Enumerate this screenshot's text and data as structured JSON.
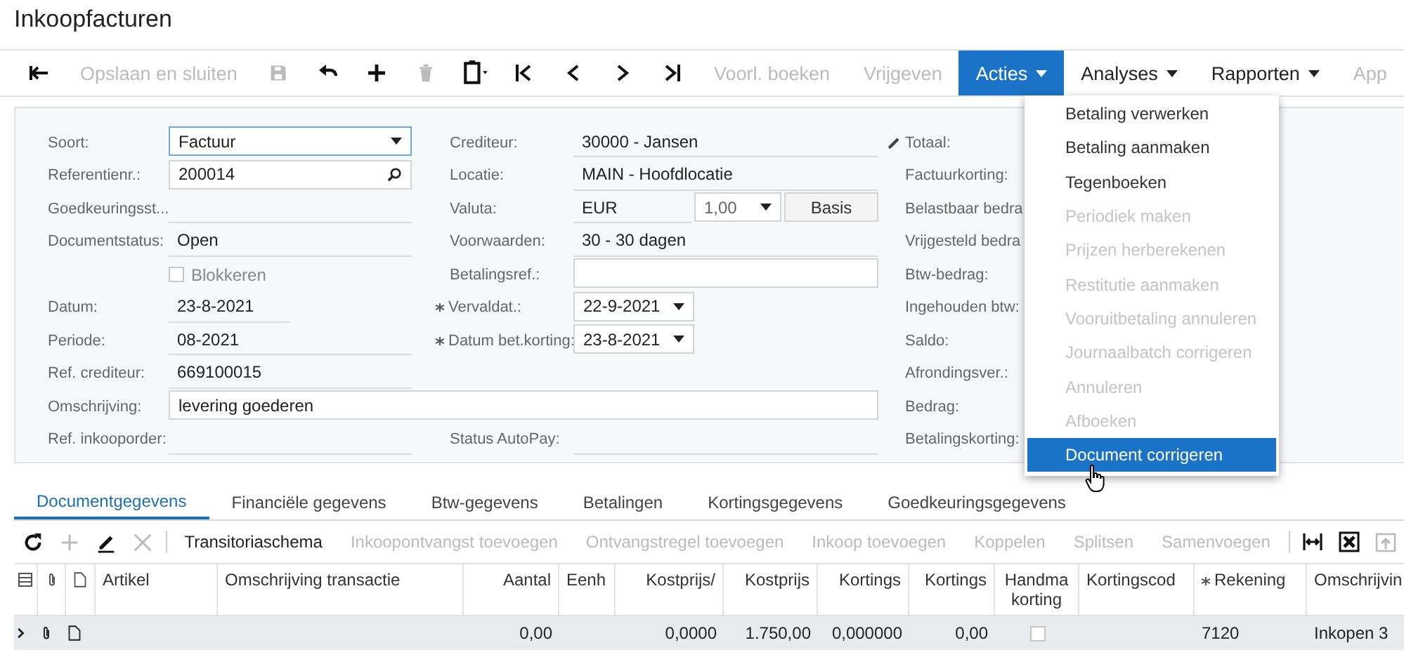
{
  "window": {
    "title": "Inkoopfacturen"
  },
  "toolbar": [
    {
      "kind": "icon",
      "disabled": false
    },
    {
      "kind": "text",
      "label": "Opslaan en sluiten",
      "disabled": true
    },
    {
      "kind": "icon",
      "disabled": true
    },
    {
      "kind": "icon",
      "disabled": false
    },
    {
      "kind": "icon",
      "disabled": false
    },
    {
      "kind": "icon",
      "disabled": true
    },
    {
      "kind": "icon",
      "disabled": false
    },
    {
      "kind": "icon",
      "disabled": false
    },
    {
      "kind": "icon",
      "disabled": false
    },
    {
      "kind": "icon",
      "disabled": false
    },
    {
      "kind": "icon",
      "disabled": false
    },
    {
      "kind": "text",
      "label": "Voorl. boeken",
      "disabled": true
    },
    {
      "kind": "text",
      "label": "Vrijgeven",
      "disabled": true
    },
    {
      "kind": "menu",
      "label": "Acties",
      "disabled": false,
      "expanded": true
    },
    {
      "kind": "menu",
      "label": "Analyses",
      "disabled": false,
      "expanded": false
    },
    {
      "kind": "menu",
      "label": "Rapporten",
      "disabled": false,
      "expanded": false
    },
    {
      "kind": "text",
      "label": "App",
      "disabled": true
    }
  ],
  "actions_menu": [
    {
      "label": "Betaling verwerken",
      "disabled": false,
      "highlighted": false
    },
    {
      "label": "Betaling aanmaken",
      "disabled": false,
      "highlighted": false
    },
    {
      "label": "Tegenboeken",
      "disabled": false,
      "highlighted": false
    },
    {
      "label": "Periodiek maken",
      "disabled": true,
      "highlighted": false
    },
    {
      "label": "Prijzen herberekenen",
      "disabled": true,
      "highlighted": false
    },
    {
      "label": "Restitutie aanmaken",
      "disabled": true,
      "highlighted": false
    },
    {
      "label": "Vooruitbetaling annuleren",
      "disabled": true,
      "highlighted": false
    },
    {
      "label": "Journaalbatch corrigeren",
      "disabled": true,
      "highlighted": false
    },
    {
      "label": "Annuleren",
      "disabled": true,
      "highlighted": false
    },
    {
      "label": "Afboeken",
      "disabled": true,
      "highlighted": false
    },
    {
      "label": "Document corrigeren",
      "disabled": false,
      "highlighted": true
    }
  ],
  "form": {
    "left": [
      {
        "label": "Soort:",
        "kind": "select",
        "value": "Factuur",
        "focused": true
      },
      {
        "label": "Referentienr.:",
        "kind": "search",
        "value": "200014"
      },
      {
        "label": "Goedkeuringsst...",
        "kind": "readonly"
      },
      {
        "label": "Documentstatus:",
        "kind": "readonly",
        "value": "Open"
      },
      {
        "kind": "checkbox",
        "label": "Blokkeren",
        "checked": false
      },
      {
        "label": "Datum:",
        "kind": "readonly-short",
        "value": "23-8-2021"
      },
      {
        "label": "Periode:",
        "kind": "readonly",
        "value": "08-2021"
      },
      {
        "label": "Ref. crediteur:",
        "kind": "readonly",
        "value": "669100015"
      },
      {
        "label": "Omschrijving:",
        "kind": "wide-input",
        "value": "levering goederen"
      },
      {
        "label": "Ref. inkooporder:",
        "kind": "readonly"
      }
    ],
    "middle": [
      {
        "label": "Crediteur:",
        "kind": "readonly",
        "value": "30000 - Jansen"
      },
      {
        "label": "Locatie:",
        "kind": "readonly",
        "value": "MAIN - Hoofdlocatie"
      },
      {
        "label": "Valuta:",
        "kind": "currency",
        "value": "EUR",
        "rate": "1,00",
        "button": "Basis"
      },
      {
        "label": "Voorwaarden:",
        "kind": "readonly",
        "value": "30 - 30 dagen"
      },
      {
        "label": "Betalingsref.:",
        "kind": "input"
      },
      {
        "label": "Vervaldat.:",
        "kind": "date",
        "value": "22-9-2021",
        "required": true
      },
      {
        "label": "Datum bet.korting:",
        "kind": "date",
        "value": "23-8-2021",
        "required": true
      },
      {
        "label": "Status AutoPay:",
        "kind": "readonly"
      }
    ],
    "right": [
      {
        "label": "Totaal:",
        "editable": true
      },
      {
        "label": "Factuurkorting:",
        "editable": false
      },
      {
        "label": "Belastbaar bedra",
        "editable": false
      },
      {
        "label": "Vrijgesteld bedra",
        "editable": false
      },
      {
        "label": "Btw-bedrag:",
        "editable": false
      },
      {
        "label": "Ingehouden btw:",
        "editable": false
      },
      {
        "label": "Saldo:",
        "editable": false
      },
      {
        "label": "Afrondingsver.:",
        "editable": false
      },
      {
        "label": "Bedrag:",
        "editable": false
      },
      {
        "label": "Betalingskorting:",
        "editable": false
      }
    ]
  },
  "tabs": [
    {
      "label": "Documentgegevens",
      "selected": true
    },
    {
      "label": "Financiële gegevens",
      "selected": false
    },
    {
      "label": "Btw-gegevens",
      "selected": false
    },
    {
      "label": "Betalingen",
      "selected": false
    },
    {
      "label": "Kortingsgegevens",
      "selected": false
    },
    {
      "label": "Goedkeuringsgegevens",
      "selected": false
    }
  ],
  "grid_toolbar": [
    {
      "kind": "icon",
      "disabled": false
    },
    {
      "kind": "icon",
      "disabled": true
    },
    {
      "kind": "icon",
      "disabled": false
    },
    {
      "kind": "icon",
      "disabled": true
    },
    {
      "kind": "text",
      "label": "Transitoriaschema",
      "disabled": false
    },
    {
      "kind": "text",
      "label": "Inkoopontvangst toevoegen",
      "disabled": true
    },
    {
      "kind": "text",
      "label": "Ontvangstregel toevoegen",
      "disabled": true
    },
    {
      "kind": "text",
      "label": "Inkoop toevoegen",
      "disabled": true
    },
    {
      "kind": "text",
      "label": "Koppelen",
      "disabled": true
    },
    {
      "kind": "text",
      "label": "Splitsen",
      "disabled": true
    },
    {
      "kind": "text",
      "label": "Samenvoegen",
      "disabled": true
    },
    {
      "kind": "icon",
      "disabled": false
    },
    {
      "kind": "icon",
      "disabled": false
    },
    {
      "kind": "icon",
      "disabled": true
    }
  ],
  "table": {
    "columns": [
      {
        "label": "Artikel",
        "kind": "text"
      },
      {
        "label": "Omschrijving transactie",
        "kind": "text"
      },
      {
        "label": "Aantal",
        "kind": "number"
      },
      {
        "label": "Eenh",
        "kind": "text"
      },
      {
        "label": "Kostprijs/",
        "kind": "number"
      },
      {
        "label": "Kostprijs",
        "kind": "number"
      },
      {
        "label": "Kortings",
        "kind": "number"
      },
      {
        "label": "Kortings",
        "kind": "number"
      },
      {
        "label": "Handma korting",
        "kind": "check"
      },
      {
        "label": "Kortingscod",
        "kind": "text"
      },
      {
        "label": "Rekening",
        "kind": "text",
        "required": true
      },
      {
        "label": "Omschrijvin",
        "kind": "text"
      }
    ],
    "rows": [
      {
        "selected": true,
        "cells": [
          "",
          "",
          "0,00",
          "",
          "0,0000",
          "1.750,00",
          "0,000000",
          "0,00",
          false,
          "",
          "7120",
          "Inkopen 3"
        ]
      }
    ]
  }
}
